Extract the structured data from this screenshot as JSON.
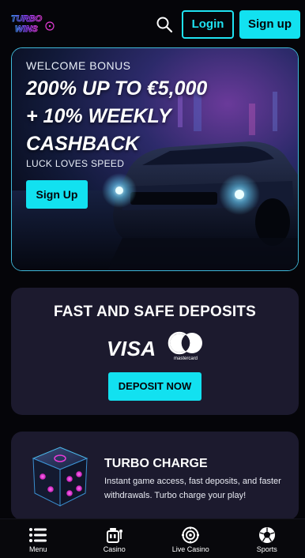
{
  "header": {
    "logo_text_line1": "TURBO",
    "logo_text_line2": "WINS",
    "login_label": "Login",
    "signup_label": "Sign up"
  },
  "hero": {
    "kicker": "WELCOME BONUS",
    "headline_line1": "200% UP TO €5,000",
    "headline_line2": "+ 10% WEEKLY",
    "headline_line3": "CASHBACK",
    "tagline": "LUCK LOVES SPEED",
    "cta_label": "Sign Up"
  },
  "deposits": {
    "title": "FAST AND SAFE DEPOSITS",
    "visa_label": "VISA",
    "mastercard_label": "mastercard",
    "cta_label": "DEPOSIT NOW"
  },
  "turbo": {
    "title": "TURBO CHARGE",
    "description": "Instant game access, fast deposits, and faster withdrawals. Turbo charge your play!"
  },
  "bottom_nav": {
    "items": [
      {
        "label": "Menu",
        "icon": "menu-icon"
      },
      {
        "label": "Casino",
        "icon": "casino-icon"
      },
      {
        "label": "Live Casino",
        "icon": "live-casino-icon"
      },
      {
        "label": "Sports",
        "icon": "sports-icon"
      }
    ]
  },
  "colors": {
    "accent": "#12e1f0",
    "background": "#050509",
    "card": "#1c1a2e",
    "logo_pink": "#e23bd4",
    "logo_purple": "#7d3cf0"
  }
}
